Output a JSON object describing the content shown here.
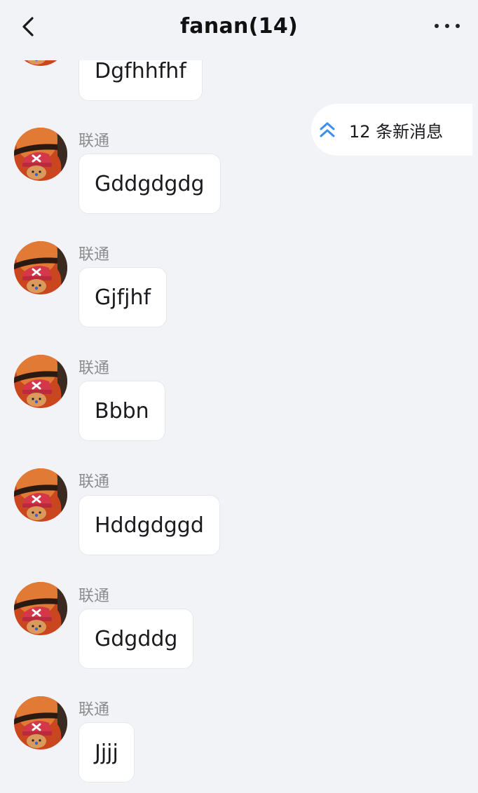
{
  "header": {
    "title": "fanan(14)"
  },
  "new_messages": {
    "label": "12 条新消息",
    "accent": "#3d8ee9"
  },
  "messages": [
    {
      "sender": "",
      "text": "Dgfhhfhf"
    },
    {
      "sender": "联通",
      "text": "Gddgdgdg"
    },
    {
      "sender": "联通",
      "text": "Gjfjhf"
    },
    {
      "sender": "联通",
      "text": "Bbbn"
    },
    {
      "sender": "联通",
      "text": "Hddgdggd"
    },
    {
      "sender": "联通",
      "text": "Gdgddg"
    },
    {
      "sender": "联通",
      "text": "Jjjj"
    }
  ],
  "icons": {
    "back": "back-arrow-icon",
    "more": "more-dots-icon",
    "new_messages": "double-chevron-up-icon",
    "avatar": "user-avatar"
  }
}
